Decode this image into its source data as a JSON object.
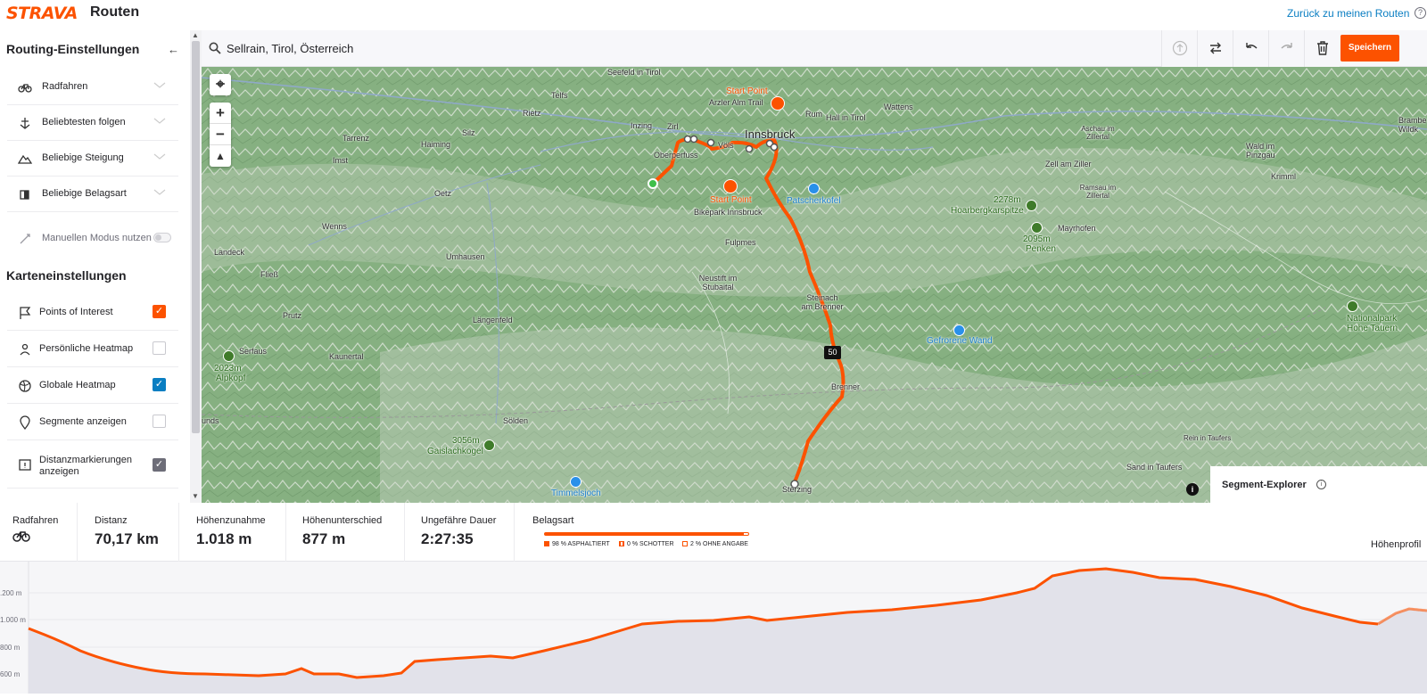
{
  "header": {
    "logo": "STRAVA",
    "title": "Routen",
    "back_link": "Zurück zu meinen Routen",
    "help_icon": "?"
  },
  "sidebar": {
    "routing_title": "Routing-Einstellungen",
    "routing_options": [
      {
        "label": "Radfahren",
        "icon": "bike-icon"
      },
      {
        "label": "Beliebtesten folgen",
        "icon": "popularity-icon"
      },
      {
        "label": "Beliebige Steigung",
        "icon": "elevation-icon"
      },
      {
        "label": "Beliebige Belagsart",
        "icon": "surface-icon"
      }
    ],
    "manual_mode": "Manuellen Modus nutzen",
    "map_title": "Karteneinstellungen",
    "map_options": [
      {
        "label": "Points of Interest",
        "icon": "flag-icon",
        "checked": true,
        "color": "#fc5200"
      },
      {
        "label": "Persönliche Heatmap",
        "icon": "person-icon",
        "checked": false
      },
      {
        "label": "Globale Heatmap",
        "icon": "globe-icon",
        "checked": true,
        "color": "#0a7ec2"
      },
      {
        "label": "Segmente anzeigen",
        "icon": "pin-icon",
        "checked": false
      },
      {
        "label": "Distanzmarkierungen anzeigen",
        "icon": "distance-marker-icon",
        "checked": true,
        "color": "#6d6d78"
      }
    ]
  },
  "search": {
    "value": "Sellrain, Tirol, Österreich"
  },
  "toolbar": {
    "save_label": "Speichern"
  },
  "map": {
    "places": [
      {
        "name": "Seefeld in Tirol"
      },
      {
        "name": "Telfs"
      },
      {
        "name": "Rietz"
      },
      {
        "name": "Inzing"
      },
      {
        "name": "Zirl"
      },
      {
        "name": "Innsbruck"
      },
      {
        "name": "Völs"
      },
      {
        "name": "Rum"
      },
      {
        "name": "Hall in Tirol"
      },
      {
        "name": "Wattens"
      },
      {
        "name": "Arzler Alm Trail"
      },
      {
        "name": "Tarrenz"
      },
      {
        "name": "Imst"
      },
      {
        "name": "Haiming"
      },
      {
        "name": "Silz"
      },
      {
        "name": "Oberperfuss"
      },
      {
        "name": "Oetz"
      },
      {
        "name": "Bikepark Innsbruck"
      },
      {
        "name": "Wenns"
      },
      {
        "name": "Fulpmes"
      },
      {
        "name": "Landeck"
      },
      {
        "name": "Umhausen"
      },
      {
        "name": "Neustift im Stubaital"
      },
      {
        "name": "Steinach am Brenner"
      },
      {
        "name": "Fließ"
      },
      {
        "name": "Prutz"
      },
      {
        "name": "Längenfeld"
      },
      {
        "name": "Serfaus"
      },
      {
        "name": "Kaunertal"
      },
      {
        "name": "Brenner"
      },
      {
        "name": "Sölden"
      },
      {
        "name": "Sterzing"
      },
      {
        "name": "Aschau im Zillertal"
      },
      {
        "name": "Zell am Ziller"
      },
      {
        "name": "Ramsau im Zillertal"
      },
      {
        "name": "Mayrhofen"
      },
      {
        "name": "Wald im Pinzgau"
      },
      {
        "name": "Krimml"
      },
      {
        "name": "Rein in Taufers"
      },
      {
        "name": "Sand in Taufers"
      },
      {
        "name": "Brambe Wildk"
      },
      {
        "name": "unds"
      }
    ],
    "pois": [
      {
        "label": "Start Point",
        "type": "orange"
      },
      {
        "label": "Start Point",
        "type": "orange"
      },
      {
        "label": "Patscherkofel",
        "type": "blue"
      },
      {
        "label": "2278m",
        "sub": "Hoarbergkarspitze",
        "type": "green"
      },
      {
        "label": "2095m",
        "sub": "Penken",
        "type": "green"
      },
      {
        "label": "Gefrorene Wand",
        "type": "blue"
      },
      {
        "label": "2023m",
        "sub": "Alpkopf",
        "type": "green"
      },
      {
        "label": "3056m",
        "sub": "Gaislachkogel",
        "type": "green"
      },
      {
        "label": "Timmelsjoch",
        "type": "blue"
      },
      {
        "label": "Nationalpark",
        "sub": "Hohe Tauern",
        "type": "green"
      }
    ],
    "distance_marker": "50",
    "info_icon": "i",
    "segment_explorer": "Segment-Explorer",
    "route_color": "#fc5200"
  },
  "stats": {
    "activity": {
      "title": "Radfahren",
      "icon": "bike-icon"
    },
    "distance": {
      "title": "Distanz",
      "value": "70,17 km"
    },
    "gain": {
      "title": "Höhenzunahme",
      "value": "1.018 m"
    },
    "diff": {
      "title": "Höhenunterschied",
      "value": "877 m"
    },
    "duration": {
      "title": "Ungefähre Dauer",
      "value": "2:27:35"
    },
    "surface": {
      "title": "Belagsart",
      "paved_fraction": 0.98,
      "legend": [
        "98 % ASPHALTIERT",
        "0 % SCHOTTER",
        "2 % OHNE ANGABE"
      ]
    },
    "elevation_profile_label": "Höhenprofil"
  },
  "profile": {
    "yticks": [
      ".200 m",
      "1.000 m",
      "800 m",
      "600 m"
    ]
  }
}
